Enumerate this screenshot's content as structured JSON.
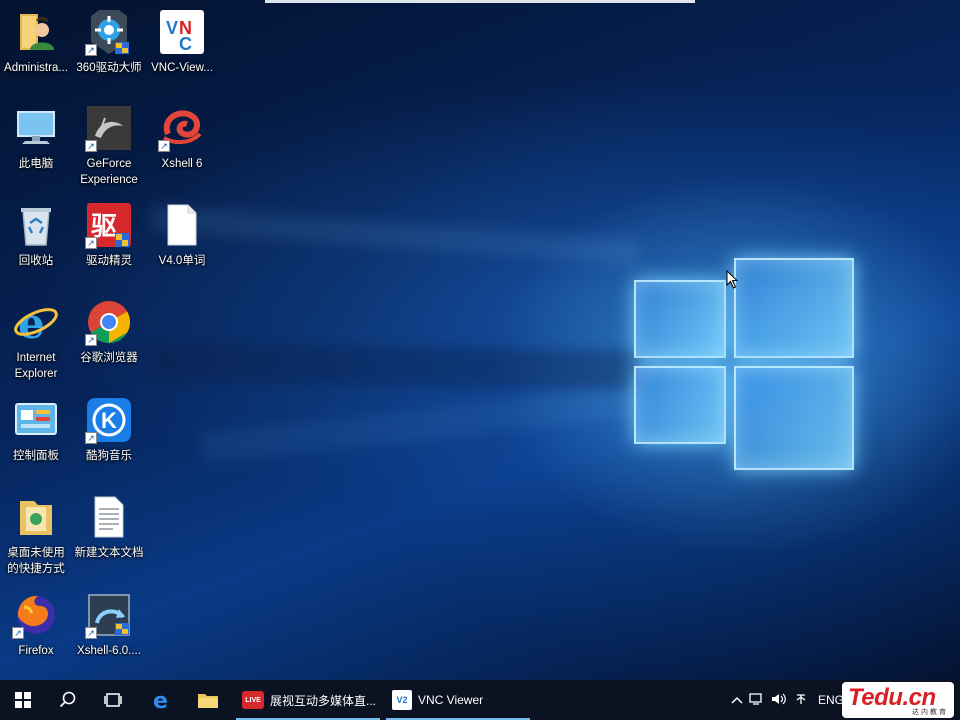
{
  "desktop": {
    "icons": [
      {
        "label": "Administra...",
        "icon": "user-folder-icon"
      },
      {
        "label": "360驱动大师",
        "icon": "driver-master-icon"
      },
      {
        "label": "VNC-View...",
        "icon": "vnc-viewer-icon"
      },
      {
        "label": "此电脑",
        "icon": "this-pc-icon"
      },
      {
        "label": "GeForce",
        "label2": "Experience",
        "icon": "geforce-icon"
      },
      {
        "label": "Xshell 6",
        "icon": "xshell-icon"
      },
      {
        "label": "回收站",
        "icon": "recycle-bin-icon"
      },
      {
        "label": "驱动精灵",
        "icon": "driver-genius-icon"
      },
      {
        "label": "V4.0单词",
        "icon": "document-icon"
      },
      {
        "label": "Internet",
        "label2": "Explorer",
        "icon": "internet-explorer-icon"
      },
      {
        "label": "谷歌浏览器",
        "icon": "chrome-icon"
      },
      {
        "label": "控制面板",
        "icon": "control-panel-icon"
      },
      {
        "label": "酷狗音乐",
        "icon": "kugou-icon"
      },
      {
        "label": "桌面未使用",
        "label2": "的快捷方式",
        "icon": "unused-shortcuts-folder-icon"
      },
      {
        "label": "新建文本文档",
        "icon": "text-document-icon"
      },
      {
        "label": "Firefox",
        "icon": "firefox-icon"
      },
      {
        "label": "Xshell-6.0....",
        "icon": "xshell-installer-icon"
      }
    ]
  },
  "taskbar": {
    "apps": [
      {
        "label": "展视互动多媒体直...",
        "icon": "live-icon",
        "badge": "LIVE"
      },
      {
        "label": "VNC Viewer",
        "icon": "vnc-viewer-icon",
        "badge": "V2"
      }
    ],
    "tray": {
      "language": "ENG"
    }
  },
  "watermark": {
    "brand": "Tedu.cn",
    "sub": "达内教育"
  },
  "colors": {
    "accent": "#76b9ed",
    "taskbar_bg": "#0b1222"
  }
}
